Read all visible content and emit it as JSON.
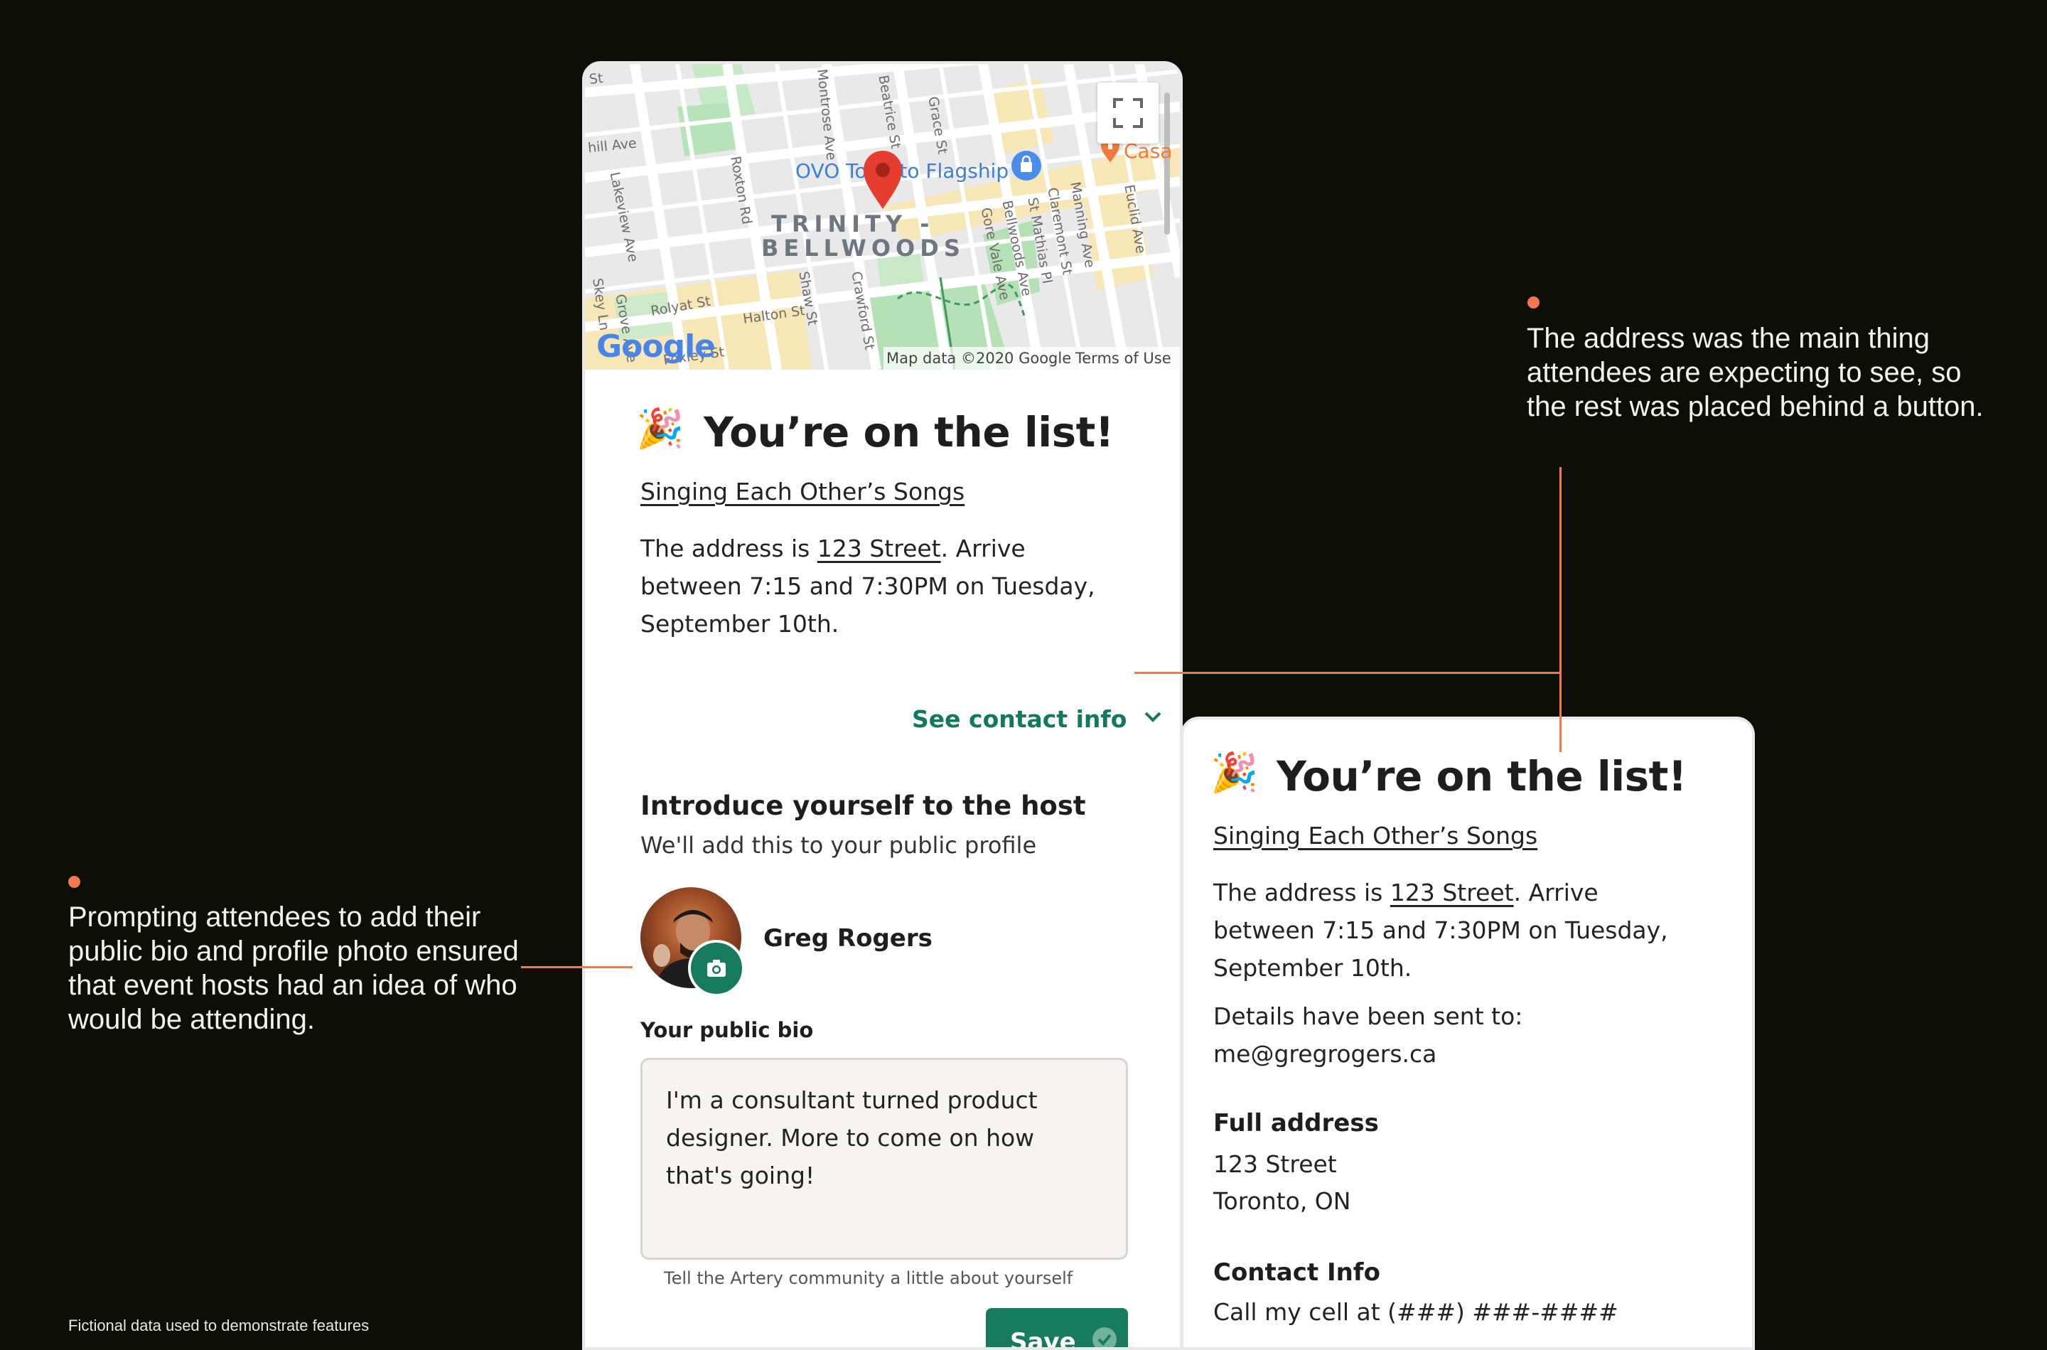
{
  "colors": {
    "background": "#0e0e08",
    "accent": "#f4784d",
    "teal": "#12785e",
    "save_button": "#177a5c",
    "map_pin": "#e53d30"
  },
  "map": {
    "streets": [
      "St",
      "hill Ave",
      "Montrose Ave",
      "Beatrice St",
      "Grace St",
      "Roxton Rd",
      "Lakeview Ave",
      "Gore Vale Ave",
      "Bellwoods Ave",
      "St Mathias Pl",
      "Claremont St",
      "Manning Ave",
      "Euclid Ave",
      "Shaw St",
      "Crawford St",
      "Halton St",
      "Rolyat St",
      "Grove Ave",
      "Skey Ln",
      "Foxley St"
    ],
    "poi_label": "OVO Toronto Flagship",
    "poi_right": "Casa",
    "neighbourhood_line1": "TRINITY -",
    "neighbourhood_line2": "BELLWOODS",
    "google_logo": "Google",
    "attribution": "Map data ©2020 Google",
    "terms": "Terms of Use",
    "fullscreen_icon": "fullscreen-icon"
  },
  "left_card": {
    "emoji": "🎉",
    "title": "You’re on the list!",
    "event_name": "Singing Each Other’s Songs",
    "address_prefix": "The address is ",
    "address": "123 Street",
    "address_suffix": ". Arrive between 7:15 and 7:30PM on Tuesday, September 10th.",
    "contact_toggle": "See contact info",
    "intro_heading": "Introduce yourself to the host",
    "intro_sub": "We'll add this to your public profile",
    "user_name": "Greg Rogers",
    "bio_label": "Your public bio",
    "bio_value": "I'm a consultant turned product designer. More to come on how that's going!",
    "bio_helper": "Tell the Artery community a little about yourself",
    "save_label": "Save"
  },
  "right_card": {
    "emoji": "🎉",
    "title": "You’re on the list!",
    "event_name": "Singing Each Other’s Songs",
    "address_prefix": "The address is ",
    "address": "123 Street",
    "address_suffix": ". Arrive between 7:15 and 7:30PM on Tuesday, September 10th.",
    "details_label": "Details have been sent to:",
    "details_email": "me@gregrogers.ca",
    "full_address_heading": "Full address",
    "address_line1": "123 Street",
    "address_line2": "Toronto, ON",
    "contact_heading": "Contact Info",
    "contact_line": "Call my cell at (###) ###-####"
  },
  "annotations": {
    "right_note": "The address was the main thing attendees are expecting to see, so the rest was placed behind a button.",
    "left_note": "Prompting attendees to add their public bio and profile photo ensured that event hosts had an idea of who would be attending.",
    "footnote": "Fictional data used to demonstrate features"
  }
}
